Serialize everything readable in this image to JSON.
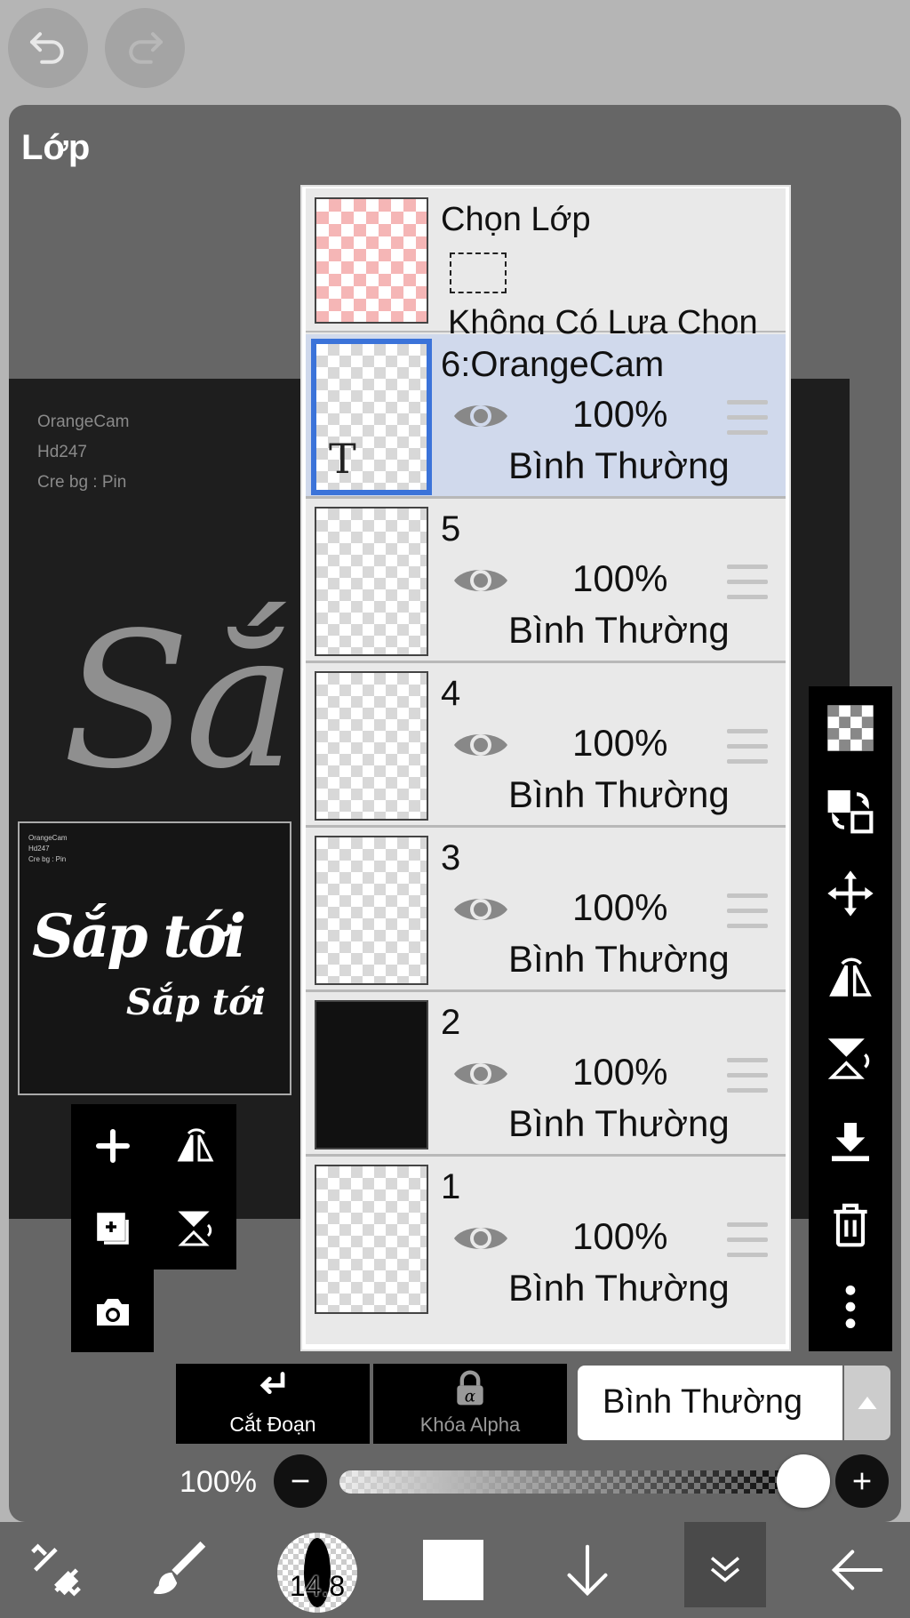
{
  "panel": {
    "title": "Lớp"
  },
  "canvas": {
    "credits": [
      "OrangeCam",
      "Hd247",
      "Cre bg : Pin"
    ],
    "big_script_text": "Sắ",
    "thumb_script_1": "Sắp tới",
    "thumb_script_2": "Sắp tới"
  },
  "selection": {
    "title": "Chọn Lớp",
    "subtitle": "Không Có Lựa Chọn"
  },
  "layers": [
    {
      "name": "6:OrangeCam",
      "opacity": "100%",
      "mode": "Bình Thường",
      "active": true,
      "is_text": true
    },
    {
      "name": "5",
      "opacity": "100%",
      "mode": "Bình Thường",
      "active": false
    },
    {
      "name": "4",
      "opacity": "100%",
      "mode": "Bình Thường",
      "active": false
    },
    {
      "name": "3",
      "opacity": "100%",
      "mode": "Bình Thường",
      "active": false
    },
    {
      "name": "2",
      "opacity": "100%",
      "mode": "Bình Thường",
      "active": false,
      "dark": true
    },
    {
      "name": "1",
      "opacity": "100%",
      "mode": "Bình Thường",
      "active": false
    }
  ],
  "bottom_controls": {
    "clip_label": "Cắt Đoạn",
    "alpha_lock_label": "Khóa Alpha",
    "blend_mode": "Bình Thường",
    "opacity_label": "100%",
    "opacity_value": 1.0
  },
  "toolbar": {
    "brush_size": "14.8"
  },
  "colors": {
    "accent": "#3b73d9",
    "active_row": "#d0d9ec",
    "panel": "#666666"
  }
}
